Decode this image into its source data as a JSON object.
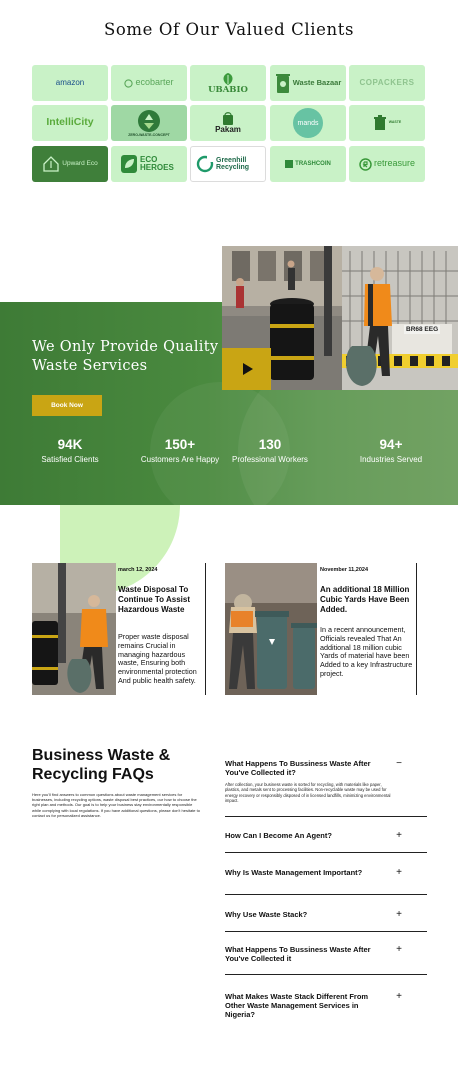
{
  "clients": {
    "title": "Some Of Our Valued Clients",
    "logos": [
      {
        "name": "amazon",
        "text": "amazon"
      },
      {
        "name": "ecobarter",
        "text": "ecobarter"
      },
      {
        "name": "ubabio",
        "text": "UBABIO"
      },
      {
        "name": "waste-bazaar",
        "text": "Waste Bazaar"
      },
      {
        "name": "copackers",
        "text": "COPACKERS"
      },
      {
        "name": "intellicity",
        "text": "IntelliCity"
      },
      {
        "name": "zero-waste-concept",
        "text": "ZERO-WASTE-CONCEPT"
      },
      {
        "name": "pakam",
        "text": "Pakam"
      },
      {
        "name": "mands",
        "text": "mands"
      },
      {
        "name": "waste-recycle",
        "text": "WASTE"
      },
      {
        "name": "upward-eco",
        "text": "Upward Eco"
      },
      {
        "name": "eco-heroes",
        "text": "ECO HEROES"
      },
      {
        "name": "greenhill-recycling",
        "text": "Greenhill Recycling"
      },
      {
        "name": "trashcoin",
        "text": "TRASHCOIN"
      },
      {
        "name": "retreasure",
        "text": "retreasure"
      }
    ]
  },
  "hero": {
    "title": "We Only Provide Quality Waste Services",
    "book_label": "Book Now",
    "stats": [
      {
        "value": "94K",
        "label": "Satisfied Clients"
      },
      {
        "value": "150+",
        "label": "Customers Are Happy"
      },
      {
        "value": "130",
        "label": "Professional Workers"
      },
      {
        "value": "94+",
        "label": "Industries Served"
      }
    ],
    "truck_plate": "BR68 EEG"
  },
  "news": [
    {
      "date": "march 12, 2024",
      "title": "Waste Disposal To Continue To Assist Hazardous Waste",
      "body": "Proper waste disposal remains Crucial in managing hazardous waste, Ensuring both environmental protection And public health safety."
    },
    {
      "date": "November 11,2024",
      "title": "An additional 18 Million Cubic Yards Have Been Added.",
      "body": "In a recent announcement, Officials revealed That An additional 18 million cubic Yards of material have been Added to a key Infrastructure project."
    }
  ],
  "faq": {
    "heading": "Business Waste & Recycling FAQs",
    "intro": "Here you'll find answers to common questions about waste management services for businesses, including recycling options, waste disposal best practices, our how to choose the right plan and methods. Our goal is to help your business stay environmentally responsible while complying with local regulations. If you have additional questions, please don't hesitate to contact us for personalized assistance.",
    "items": [
      {
        "q": "What Happens To Bussiness Waste After You've Collected it?",
        "a": "After collection, your business waste is sorted for recycling, with materials like paper, plastics, and metals sent to processing facilities. Non-recyclable waste may be used for energy recovery or responsibly disposed of in licensed landfills, minimizing environmental impact.",
        "toggle": "−",
        "open": true
      },
      {
        "q": "How Can I Become An Agent?",
        "toggle": "+",
        "open": false
      },
      {
        "q": "Why Is Waste Management Important?",
        "toggle": "+",
        "open": false
      },
      {
        "q": "Why Use Waste Stack?",
        "toggle": "+",
        "open": false
      },
      {
        "q": "What Happens To Bussiness Waste After You've Collected it",
        "toggle": "+",
        "open": false
      },
      {
        "q": "What Makes Waste Stack Different From Other Waste Management Services in Nigeria?",
        "toggle": "+",
        "open": false
      }
    ]
  },
  "colors": {
    "accent_gold": "#c9a514",
    "hero_green": "#3e7b36",
    "tile_green": "#c9f2c7",
    "blob_green": "#cdf2b9"
  }
}
